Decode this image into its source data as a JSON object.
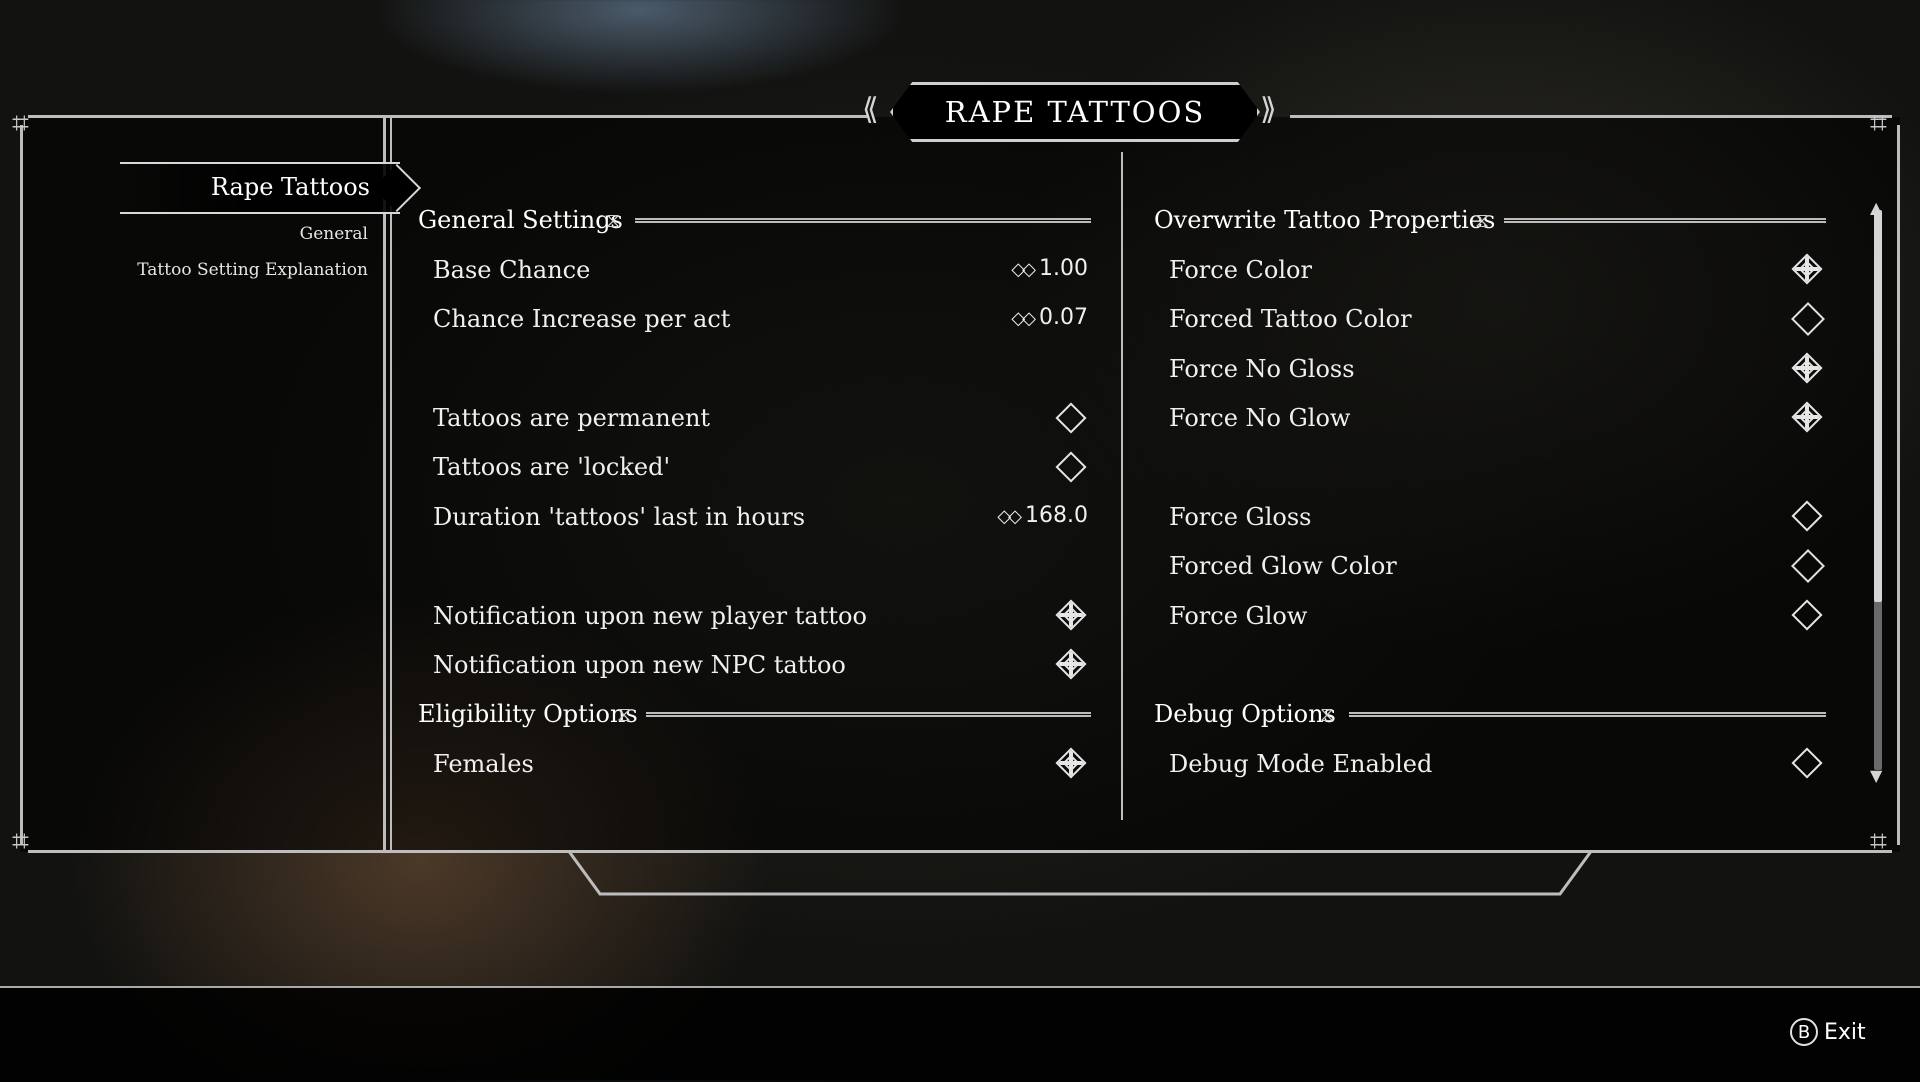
{
  "title": "RAPE TATTOOS",
  "sidebar": {
    "active": "Rape Tattoos",
    "pages": [
      "General",
      "Tattoo Setting Explanation"
    ]
  },
  "left_column": {
    "general_header": "General Settings",
    "base_chance_label": "Base Chance",
    "base_chance_value": "1.00",
    "chance_increase_label": "Chance Increase per act",
    "chance_increase_value": "0.07",
    "permanent_label": "Tattoos are permanent",
    "permanent_checked": false,
    "locked_label": "Tattoos are 'locked'",
    "locked_checked": false,
    "duration_label": "Duration 'tattoos' last in hours",
    "duration_value": "168.0",
    "notif_player_label": "Notification upon new player tattoo",
    "notif_player_checked": true,
    "notif_npc_label": "Notification upon new NPC tattoo",
    "notif_npc_checked": true,
    "eligibility_header": "Eligibility Options",
    "females_label": "Females",
    "females_checked": true
  },
  "right_column": {
    "overwrite_header": "Overwrite Tattoo Properties",
    "force_color_label": "Force Color",
    "force_color_checked": true,
    "forced_tattoo_color_label": "Forced Tattoo Color",
    "force_no_gloss_label": "Force No Gloss",
    "force_no_gloss_checked": true,
    "force_no_glow_label": "Force No Glow",
    "force_no_glow_checked": true,
    "force_gloss_label": "Force Gloss",
    "force_gloss_checked": false,
    "forced_glow_color_label": "Forced Glow Color",
    "force_glow_label": "Force Glow",
    "force_glow_checked": false,
    "debug_header": "Debug Options",
    "debug_mode_label": "Debug Mode Enabled",
    "debug_mode_checked": false
  },
  "scrollbar": {
    "position_fraction": 0.0,
    "visible_fraction": 0.7
  },
  "footer": {
    "exit_key": "B",
    "exit_label": "Exit"
  },
  "colors": {
    "frame": "#bdbdbd",
    "text": "#f0f0f0",
    "panel": "#000000"
  }
}
